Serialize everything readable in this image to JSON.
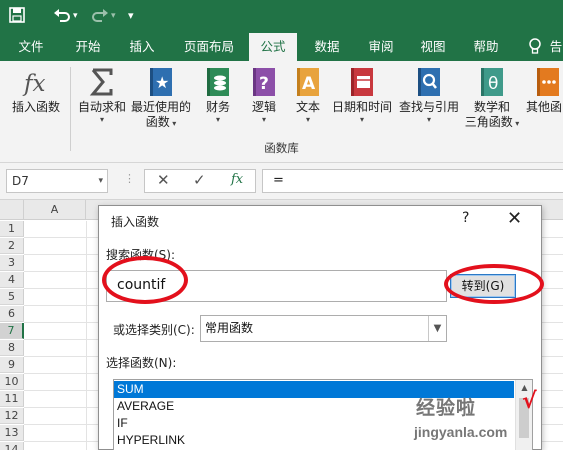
{
  "quick_access": {
    "save_icon": "save-icon",
    "undo_icon": "undo-icon",
    "redo_icon": "redo-icon",
    "customize_icon": "customize-qat-icon"
  },
  "tabs": [
    "文件",
    "开始",
    "插入",
    "页面布局",
    "公式",
    "数据",
    "审阅",
    "视图",
    "帮助",
    "告"
  ],
  "active_tab": "公式",
  "ribbon": {
    "buttons": [
      {
        "label": "插入函数",
        "label2": "",
        "icon": "fx-icon"
      },
      {
        "label": "自动求和",
        "label2": "",
        "icon": "sigma-icon"
      },
      {
        "label": "最近使用的",
        "label2": "函数",
        "icon": "star-book-icon"
      },
      {
        "label": "财务",
        "label2": "",
        "icon": "finance-book-icon"
      },
      {
        "label": "逻辑",
        "label2": "",
        "icon": "logic-book-icon"
      },
      {
        "label": "文本",
        "label2": "",
        "icon": "text-book-icon"
      },
      {
        "label": "日期和时间",
        "label2": "",
        "icon": "datetime-book-icon"
      },
      {
        "label": "查找与引用",
        "label2": "",
        "icon": "lookup-book-icon"
      },
      {
        "label": "数学和",
        "label2": "三角函数",
        "icon": "math-book-icon"
      },
      {
        "label": "其他函",
        "label2": "",
        "icon": "more-book-icon"
      }
    ],
    "group_label": "函数库"
  },
  "formula_bar": {
    "name_box": "D7",
    "cancel": "✕",
    "enter": "✓",
    "fx": "fx",
    "content": "="
  },
  "sheet": {
    "column_a": "A",
    "rows": [
      "1",
      "2",
      "3",
      "4",
      "5",
      "6",
      "7",
      "8",
      "9",
      "10",
      "11",
      "12",
      "13",
      "14"
    ],
    "selected_row": "7"
  },
  "dialog": {
    "title": "插入函数",
    "help": "?",
    "close": "✕",
    "search_label": "搜索函数(S):",
    "search_value": "countif",
    "go_button": "转到(G)",
    "category_label": "或选择类别(C):",
    "category_value": "常用函数",
    "functions_label": "选择函数(N):",
    "functions": [
      "SUM",
      "AVERAGE",
      "IF",
      "HYPERLINK"
    ],
    "selected_function": "SUM"
  },
  "watermark": {
    "line1": "经验啦",
    "check": "√",
    "line2": "jingyanla.com"
  },
  "colors": {
    "excel_green": "#217346",
    "highlight_red": "#e3101c",
    "selection_blue": "#0078d7"
  }
}
